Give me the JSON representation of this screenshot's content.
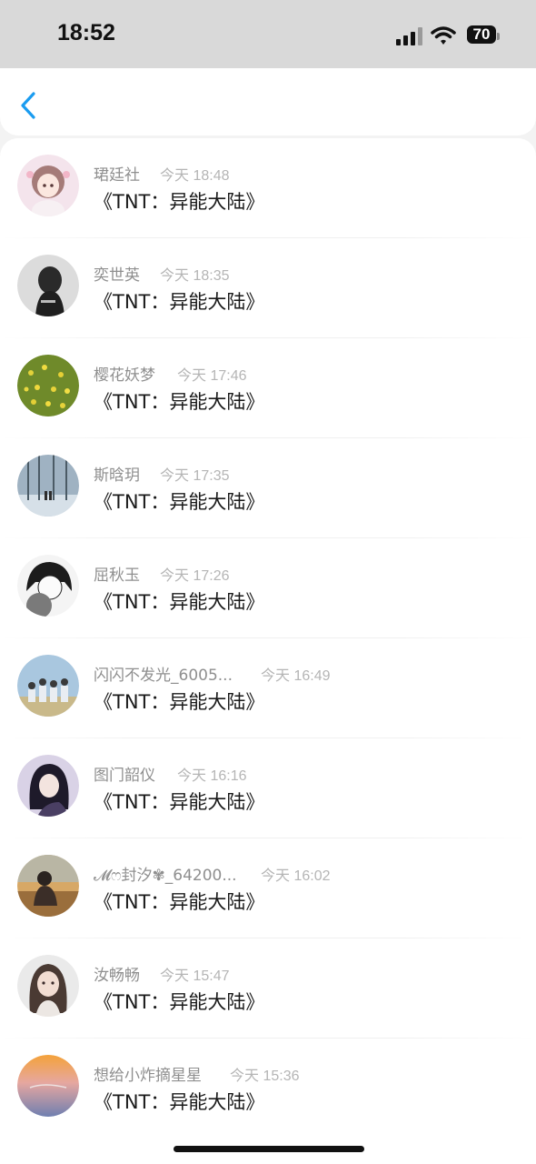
{
  "status_bar": {
    "time": "18:52",
    "battery": "70"
  },
  "messages": [
    {
      "name": "珺廷社",
      "time": "今天 18:48",
      "text": "《TNT：异能大陆》"
    },
    {
      "name": "奕世英",
      "time": "今天 18:35",
      "text": "《TNT：异能大陆》"
    },
    {
      "name": "樱花妖梦",
      "time": "今天 17:46",
      "text": "《TNT：异能大陆》"
    },
    {
      "name": "斯晗玥",
      "time": "今天 17:35",
      "text": "《TNT：异能大陆》"
    },
    {
      "name": "屈秋玉",
      "time": "今天 17:26",
      "text": "《TNT：异能大陆》"
    },
    {
      "name": "闪闪不发光_6005...",
      "time": "今天 16:49",
      "text": "《TNT：异能大陆》"
    },
    {
      "name": "图门韶仪",
      "time": "今天 16:16",
      "text": "《TNT：异能大陆》"
    },
    {
      "name": "𝓜ෆ封汐✾_64200...",
      "time": "今天 16:02",
      "text": "《TNT：异能大陆》"
    },
    {
      "name": "汝畅畅",
      "time": "今天 15:47",
      "text": "《TNT：异能大陆》"
    },
    {
      "name": "想给小炸摘星星",
      "time": "今天 15:36",
      "text": "《TNT：异能大陆》"
    }
  ],
  "colors": {
    "accent": "#1a9cf0",
    "name_text": "#8f8f8f",
    "time_text": "#b5b5b5",
    "message_text": "#1a1a1a"
  },
  "icons": [
    "back-chevron-icon",
    "cellular-signal-icon",
    "wifi-icon",
    "battery-icon"
  ]
}
